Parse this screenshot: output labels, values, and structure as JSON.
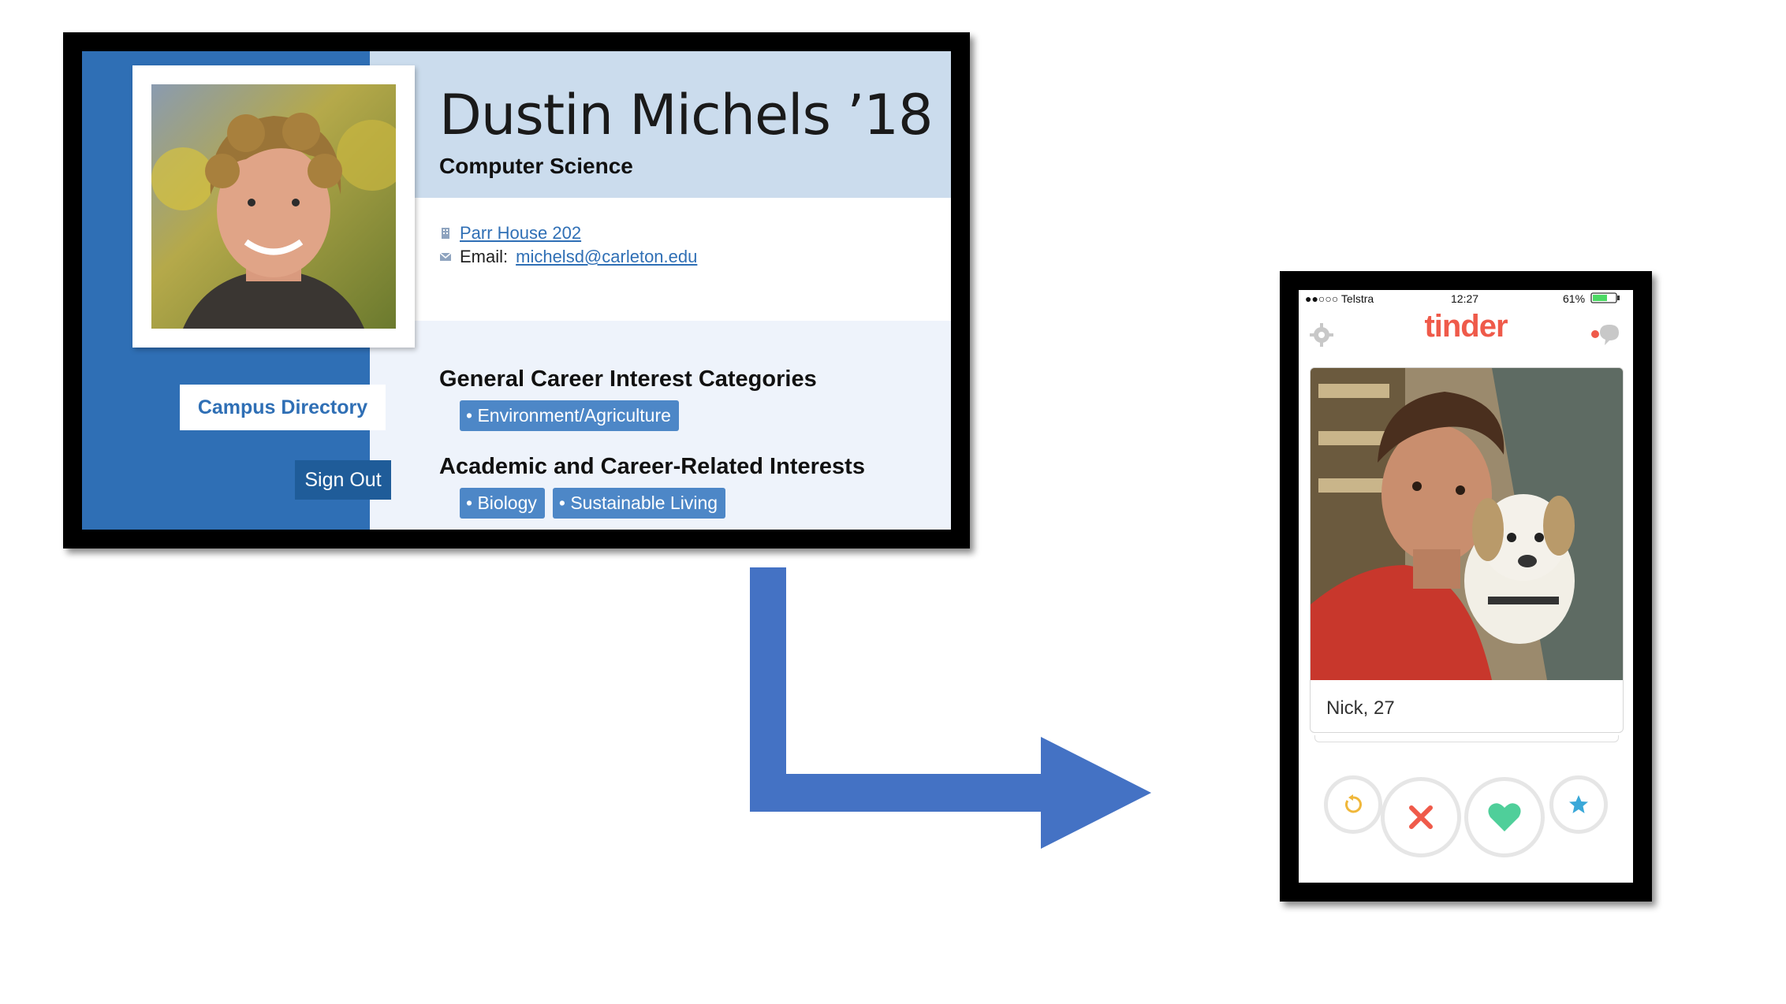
{
  "profile": {
    "name": "Dustin Michels ’18",
    "major": "Computer Science",
    "location_link": "Parr House 202",
    "email_label": "Email:",
    "email_link": "michelsd@carleton.edu",
    "career_heading": "General Career Interest Categories",
    "career_tags": [
      "Environment/Agriculture"
    ],
    "interests_heading": "Academic and Career-Related Interests",
    "interest_tags": [
      "Biology",
      "Sustainable Living"
    ],
    "campus_directory_label": "Campus Directory",
    "sign_out_label": "Sign Out",
    "icons": {
      "location": "building-icon",
      "email": "envelope-icon"
    }
  },
  "phone": {
    "status": {
      "carrier": "●●○○○ Telstra",
      "time": "12:27",
      "battery": "61%"
    },
    "app_logo": "tinder",
    "card_caption": "Nick, 27",
    "actions": [
      "rewind-icon",
      "nope-x-icon",
      "like-heart-icon",
      "super-like-star-icon"
    ]
  },
  "colors": {
    "sidebar": "#2f6fb5",
    "tinder": "#ef5a4a",
    "arrow": "#4472c4",
    "like": "#4fcf9a",
    "nope": "#ef5a4a",
    "super": "#3aa8d8",
    "rewind": "#f0b73a"
  }
}
